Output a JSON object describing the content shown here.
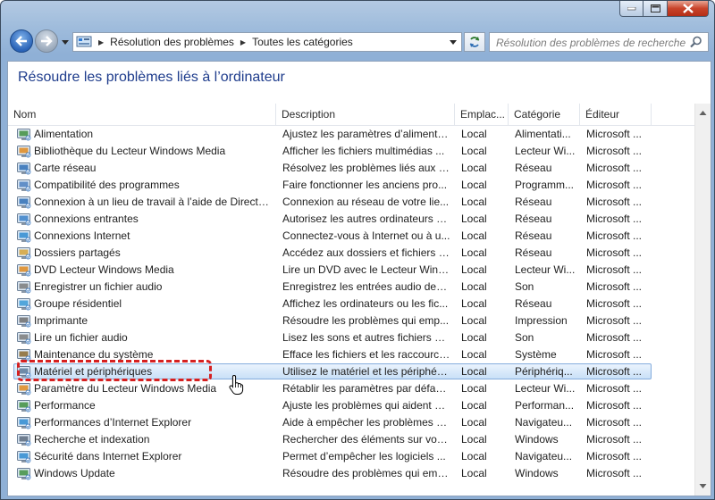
{
  "window": {
    "min_label": "",
    "address": {
      "crumbs": [
        "Résolution des problèmes",
        "Toutes les catégories"
      ]
    },
    "search": {
      "placeholder": "Résolution des problèmes de recherche"
    }
  },
  "page": {
    "title": "Résoudre les problèmes liés à l’ordinateur"
  },
  "columns": {
    "name": "Nom",
    "description": "Description",
    "location": "Emplac...",
    "category": "Catégorie",
    "editor": "Éditeur"
  },
  "rows": [
    {
      "name": "Alimentation",
      "description": "Ajustez les paramètres d’alimenta...",
      "location": "Local",
      "category": "Alimentati...",
      "editor": "Microsoft ...",
      "icon": "power-icon"
    },
    {
      "name": "Bibliothèque du Lecteur Windows Media",
      "description": "Afficher les fichiers multimédias ...",
      "location": "Local",
      "category": "Lecteur Wi...",
      "editor": "Microsoft ...",
      "icon": "media-library-icon"
    },
    {
      "name": "Carte réseau",
      "description": "Résolvez les problèmes liés aux ca...",
      "location": "Local",
      "category": "Réseau",
      "editor": "Microsoft ...",
      "icon": "network-adapter-icon"
    },
    {
      "name": "Compatibilité des programmes",
      "description": "Faire fonctionner les anciens pro...",
      "location": "Local",
      "category": "Programm...",
      "editor": "Microsoft ...",
      "icon": "program-compat-icon"
    },
    {
      "name": "Connexion à un lieu de travail à l’aide de DirectA...",
      "description": "Connexion au réseau de votre lie...",
      "location": "Local",
      "category": "Réseau",
      "editor": "Microsoft ...",
      "icon": "directaccess-icon"
    },
    {
      "name": "Connexions entrantes",
      "description": "Autorisez les autres ordinateurs à ...",
      "location": "Local",
      "category": "Réseau",
      "editor": "Microsoft ...",
      "icon": "incoming-connections-icon"
    },
    {
      "name": "Connexions Internet",
      "description": "Connectez-vous à Internet ou à u...",
      "location": "Local",
      "category": "Réseau",
      "editor": "Microsoft ...",
      "icon": "internet-connections-icon"
    },
    {
      "name": "Dossiers partagés",
      "description": "Accédez aux dossiers et fichiers p...",
      "location": "Local",
      "category": "Réseau",
      "editor": "Microsoft ...",
      "icon": "shared-folders-icon"
    },
    {
      "name": "DVD Lecteur Windows Media",
      "description": "Lire un DVD avec le Lecteur Wind...",
      "location": "Local",
      "category": "Lecteur Wi...",
      "editor": "Microsoft ...",
      "icon": "dvd-icon"
    },
    {
      "name": "Enregistrer un fichier audio",
      "description": "Enregistrez les entrées audio dep...",
      "location": "Local",
      "category": "Son",
      "editor": "Microsoft ...",
      "icon": "record-audio-icon"
    },
    {
      "name": "Groupe résidentiel",
      "description": "Affichez les ordinateurs ou les fic...",
      "location": "Local",
      "category": "Réseau",
      "editor": "Microsoft ...",
      "icon": "homegroup-icon"
    },
    {
      "name": "Imprimante",
      "description": "Résoudre les problèmes qui emp...",
      "location": "Local",
      "category": "Impression",
      "editor": "Microsoft ...",
      "icon": "printer-icon"
    },
    {
      "name": "Lire un fichier audio",
      "description": "Lisez les sons et autres fichiers au...",
      "location": "Local",
      "category": "Son",
      "editor": "Microsoft ...",
      "icon": "play-audio-icon"
    },
    {
      "name": "Maintenance du système",
      "description": "Efface les fichiers et les raccourcis...",
      "location": "Local",
      "category": "Système",
      "editor": "Microsoft ...",
      "icon": "system-maintenance-icon"
    },
    {
      "name": "Matériel et périphériques",
      "description": "Utilisez le matériel et les périphéri...",
      "location": "Local",
      "category": "Périphériq...",
      "editor": "Microsoft ...",
      "icon": "hardware-devices-icon",
      "selected": true
    },
    {
      "name": "Paramètre du Lecteur Windows Media",
      "description": "Rétablir les paramètres par défaut...",
      "location": "Local",
      "category": "Lecteur Wi...",
      "editor": "Microsoft ...",
      "icon": "media-settings-icon"
    },
    {
      "name": "Performance",
      "description": "Ajuste les problèmes qui aident à ...",
      "location": "Local",
      "category": "Performan...",
      "editor": "Microsoft ...",
      "icon": "performance-icon"
    },
    {
      "name": "Performances d’Internet Explorer",
      "description": "Aide à empêcher les problèmes d...",
      "location": "Local",
      "category": "Navigateu...",
      "editor": "Microsoft ...",
      "icon": "ie-performance-icon"
    },
    {
      "name": "Recherche et indexation",
      "description": "Rechercher des éléments sur votre...",
      "location": "Local",
      "category": "Windows",
      "editor": "Microsoft ...",
      "icon": "search-indexing-icon"
    },
    {
      "name": "Sécurité dans Internet Explorer",
      "description": "Permet d’empêcher les logiciels ...",
      "location": "Local",
      "category": "Navigateu...",
      "editor": "Microsoft ...",
      "icon": "ie-safety-icon"
    },
    {
      "name": "Windows Update",
      "description": "Résoudre des problèmes qui emp...",
      "location": "Local",
      "category": "Windows",
      "editor": "Microsoft ...",
      "icon": "windows-update-icon"
    }
  ]
}
